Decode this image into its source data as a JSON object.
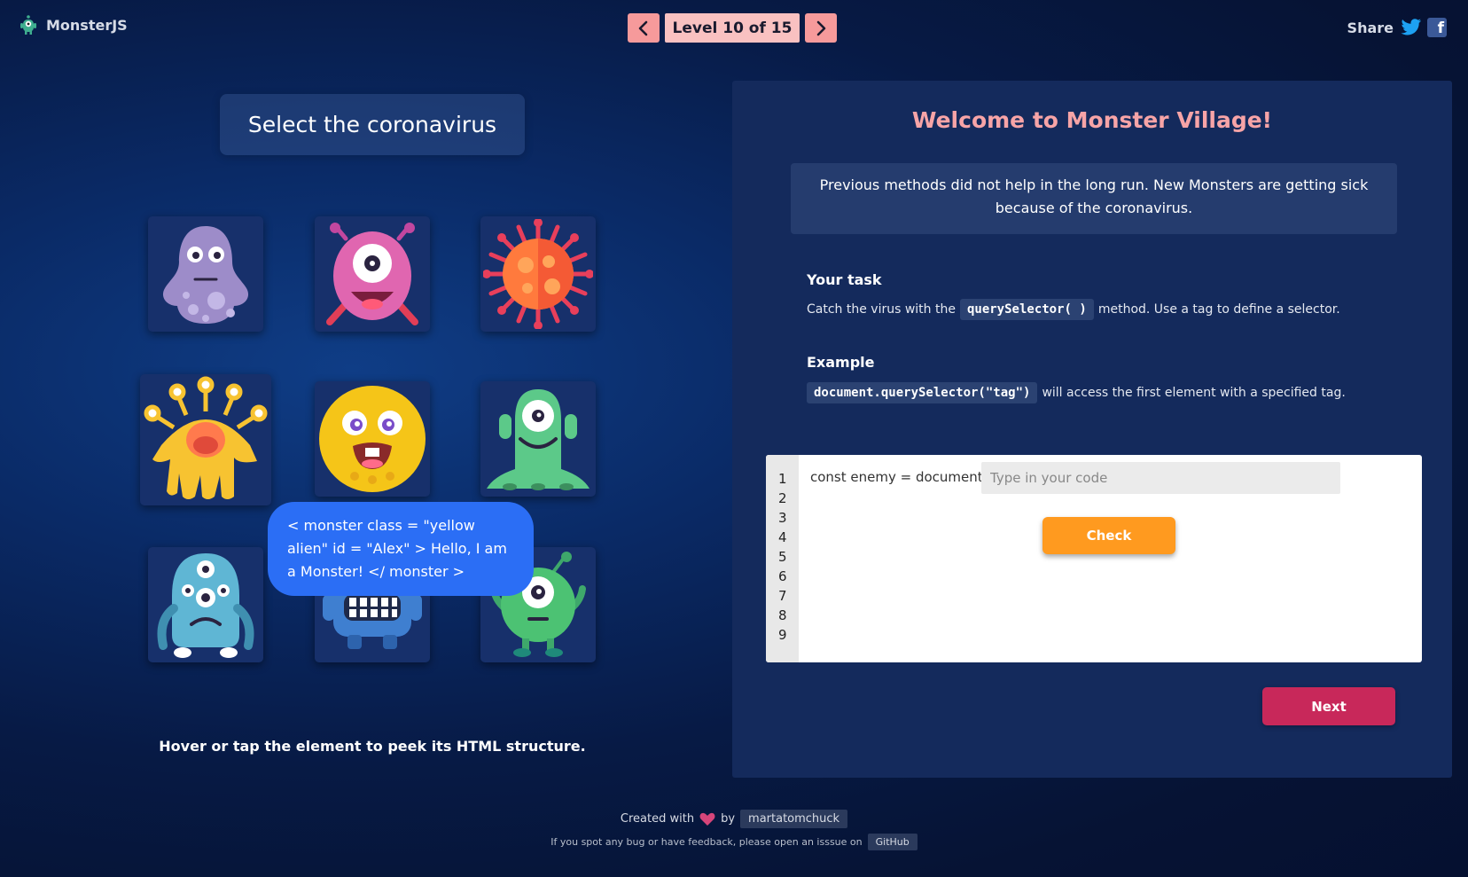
{
  "header": {
    "app_name": "MonsterJS",
    "level_label": "Level 10 of 15",
    "share_label": "Share",
    "prev_icon": "chevron-left-icon",
    "next_icon": "chevron-right-icon"
  },
  "left": {
    "title": "Select the coronavirus",
    "tooltip": "< monster class = \"yellow alien\" id = \"Alex\" > Hello, I am a Monster! </ monster >",
    "hint": "Hover or tap the element to peek its HTML structure.",
    "monsters": [
      "purple-blob",
      "pink-one-eye",
      "coronavirus",
      "yellow-alien",
      "yellow-smiley",
      "green-one-eye",
      "blue-three-eye",
      "blue-teeth",
      "green-round"
    ]
  },
  "panel": {
    "title": "Welcome to Monster Village!",
    "description": "Previous methods did not help in the long run. New Monsters are getting sick because of the coronavirus.",
    "task_heading": "Your task",
    "task_before": "Catch the virus with the",
    "task_code": "querySelector( )",
    "task_after": "method. Use a tag to define a selector.",
    "example_heading": "Example",
    "example_code": "document.querySelector(\"tag\")",
    "example_after": "will access the first element with a specified tag.",
    "editor": {
      "line_numbers": [
        "1",
        "2",
        "3",
        "4",
        "5",
        "6",
        "7",
        "8",
        "9"
      ],
      "prefix": "const enemy = document.",
      "placeholder": "Type in your code",
      "value": ""
    },
    "check_label": "Check",
    "next_label": "Next"
  },
  "footer": {
    "created_with": "Created with",
    "by": "by",
    "author": "martatomchuck",
    "feedback": "If you spot any bug or have feedback, please open an isssue on",
    "github": "GitHub"
  },
  "colors": {
    "nav_pink": "#f69a9b",
    "check_orange": "#ff9a1f",
    "next_red": "#c8285a",
    "title_pink": "#f7a4a7",
    "tooltip_blue": "#2b6ef5"
  }
}
